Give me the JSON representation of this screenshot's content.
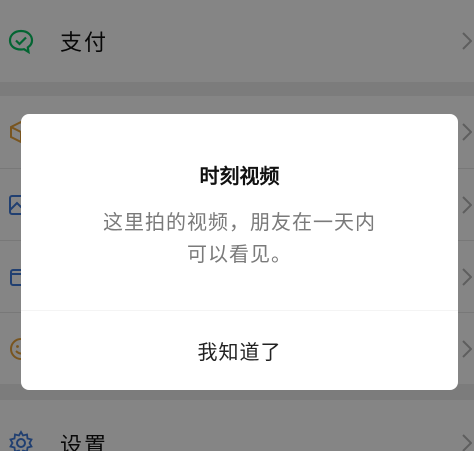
{
  "menu": {
    "pay_label": "支付",
    "settings_label": "设置"
  },
  "dialog": {
    "title": "时刻视频",
    "message_line1": "这里拍的视频，朋友在一天内",
    "message_line2": "可以看见。",
    "confirm_label": "我知道了"
  },
  "colors": {
    "wechat_green": "#07c160",
    "overlay": "rgba(0,0,0,0.48)"
  }
}
